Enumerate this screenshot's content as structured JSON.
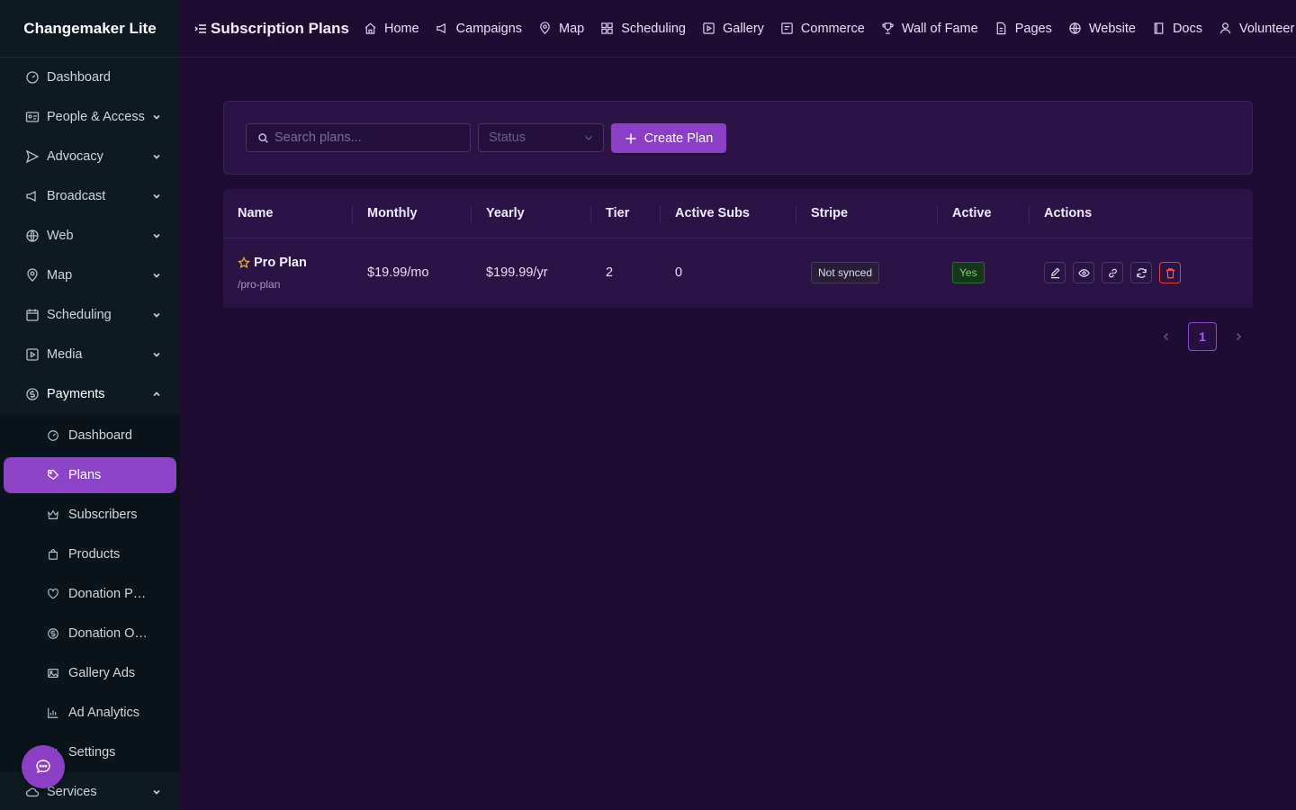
{
  "app": {
    "brand": "Changemaker Lite"
  },
  "sidebar": {
    "items": [
      {
        "label": "Dashboard",
        "icon": "gauge-icon",
        "expandable": false
      },
      {
        "label": "People & Access",
        "icon": "id-card-icon",
        "expandable": true
      },
      {
        "label": "Advocacy",
        "icon": "send-icon",
        "expandable": true
      },
      {
        "label": "Broadcast",
        "icon": "megaphone-icon",
        "expandable": true
      },
      {
        "label": "Web",
        "icon": "globe-icon",
        "expandable": true
      },
      {
        "label": "Map",
        "icon": "map-pin-icon",
        "expandable": true
      },
      {
        "label": "Scheduling",
        "icon": "calendar-icon",
        "expandable": true
      },
      {
        "label": "Media",
        "icon": "play-square-icon",
        "expandable": true
      },
      {
        "label": "Payments",
        "icon": "dollar-circle-icon",
        "expandable": true,
        "open": true
      }
    ],
    "payments_sub": [
      {
        "label": "Dashboard",
        "icon": "gauge-icon"
      },
      {
        "label": "Plans",
        "icon": "tag-icon",
        "active": true
      },
      {
        "label": "Subscribers",
        "icon": "crown-icon"
      },
      {
        "label": "Products",
        "icon": "shopping-bag-icon"
      },
      {
        "label": "Donation P…",
        "icon": "heart-icon"
      },
      {
        "label": "Donation O…",
        "icon": "dollar-circle-icon"
      },
      {
        "label": "Gallery Ads",
        "icon": "image-icon"
      },
      {
        "label": "Ad Analytics",
        "icon": "bar-chart-icon"
      },
      {
        "label": "Settings",
        "icon": "gear-icon"
      }
    ],
    "services": {
      "label": "Services",
      "icon": "cloud-icon"
    }
  },
  "topbar": {
    "page_title": "Subscription Plans",
    "links": [
      {
        "label": "Home",
        "icon": "home-icon"
      },
      {
        "label": "Campaigns",
        "icon": "megaphone-icon"
      },
      {
        "label": "Map",
        "icon": "map-pin-icon"
      },
      {
        "label": "Scheduling",
        "icon": "grid-icon"
      },
      {
        "label": "Gallery",
        "icon": "play-square-icon"
      },
      {
        "label": "Commerce",
        "icon": "shop-icon"
      },
      {
        "label": "Wall of Fame",
        "icon": "trophy-icon"
      },
      {
        "label": "Pages",
        "icon": "file-icon"
      },
      {
        "label": "Website",
        "icon": "globe-icon"
      },
      {
        "label": "Docs",
        "icon": "book-icon"
      },
      {
        "label": "Volunteer",
        "icon": "user-icon"
      }
    ]
  },
  "filters": {
    "search_placeholder": "Search plans...",
    "status_placeholder": "Status",
    "create_label": "Create Plan"
  },
  "table": {
    "columns": [
      "Name",
      "Monthly",
      "Yearly",
      "Tier",
      "Active Subs",
      "Stripe",
      "Active",
      "Actions"
    ],
    "rows": [
      {
        "name": "Pro Plan",
        "slug": "/pro-plan",
        "featured": true,
        "monthly": "$19.99/mo",
        "yearly": "$199.99/yr",
        "tier": "2",
        "active_subs": "0",
        "stripe": "Not synced",
        "active": "Yes",
        "actions": [
          "edit-icon",
          "eye-icon",
          "link-icon",
          "sync-icon",
          "trash-icon"
        ]
      }
    ]
  },
  "pagination": {
    "current": "1"
  },
  "colors": {
    "accent": "#8a3fc4",
    "background": "#1f0c33",
    "card": "#2b1346",
    "sidebar": "#0e1a22",
    "success": "#7fd26b",
    "danger": "#ff5a4e"
  }
}
